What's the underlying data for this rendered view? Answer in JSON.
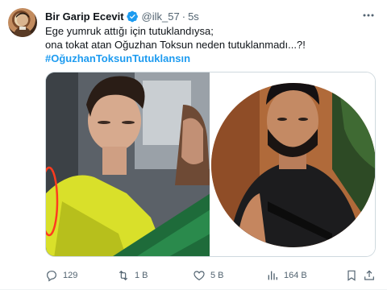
{
  "tweet": {
    "author_name": "Bir Garip Ecevit",
    "handle": "@ilk_57",
    "separator": "·",
    "time": "5s",
    "text_lines": [
      "Ege yumruk attığı için tutuklandıysa;",
      "ona tokat atan Oğuzhan Toksun neden tutuklanmadı...?!"
    ],
    "hashtag": "#OğuzhanToksunTutuklansın"
  },
  "actions": {
    "replies": "129",
    "retweets": "1 B",
    "likes": "5 B",
    "views": "164 B"
  },
  "icons": {
    "verified": "verified-badge-icon",
    "more": "more-dots-icon",
    "reply": "reply-icon",
    "retweet": "retweet-icon",
    "like": "heart-icon",
    "views": "views-chart-icon",
    "bookmark": "bookmark-icon",
    "share": "share-icon"
  },
  "colors": {
    "accent": "#1d9bf0",
    "text": "#0f1419",
    "secondary": "#536471"
  }
}
